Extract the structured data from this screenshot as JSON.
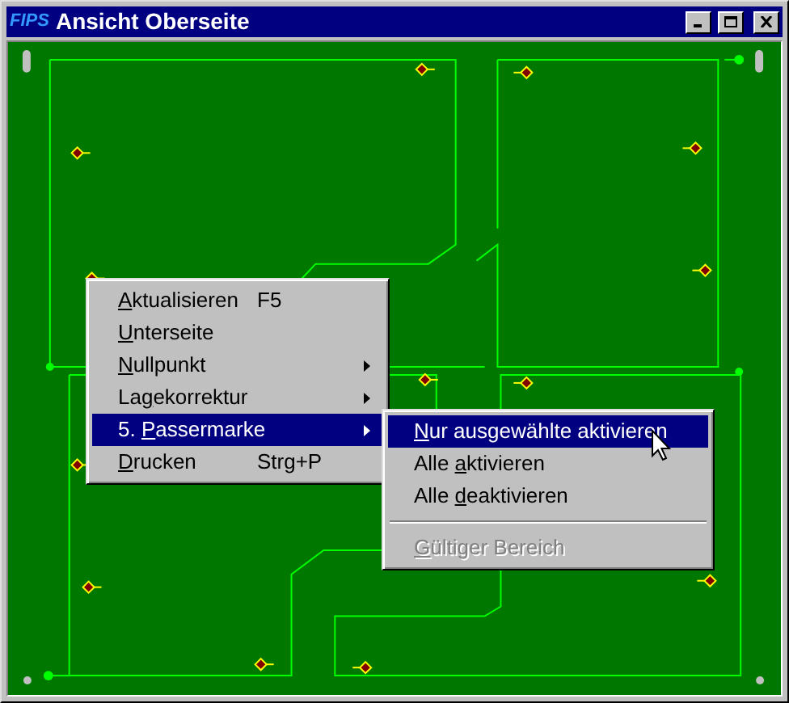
{
  "window": {
    "title": "Ansicht Oberseite",
    "logo": "FIPS"
  },
  "context_menu": [
    {
      "key": "A",
      "after": "ktualisieren",
      "shortcut": "F5",
      "submenu": false,
      "selected": false
    },
    {
      "key": "U",
      "after": "nterseite",
      "submenu": false,
      "selected": false
    },
    {
      "key": "N",
      "after": "ullpunkt",
      "submenu": true,
      "selected": false
    },
    {
      "before": "La",
      "key": "g",
      "after": "ekorrektur",
      "submenu": true,
      "selected": false
    },
    {
      "before": "5. ",
      "key": "P",
      "after": "assermarke",
      "submenu": true,
      "selected": true
    },
    {
      "key": "D",
      "after": "rucken",
      "shortcut": "Strg+P",
      "submenu": false,
      "selected": false
    }
  ],
  "submenu": [
    {
      "kind": "item",
      "key": "N",
      "after": "ur ausgewählte aktivieren",
      "selected": true,
      "disabled": false
    },
    {
      "kind": "item",
      "before": "Alle ",
      "key": "a",
      "after": "ktivieren",
      "selected": false,
      "disabled": false
    },
    {
      "kind": "item",
      "before": "Alle ",
      "key": "d",
      "after": "eaktivieren",
      "selected": false,
      "disabled": false
    },
    {
      "kind": "separator"
    },
    {
      "kind": "item",
      "key": "G",
      "after": "ültiger Bereich",
      "selected": false,
      "disabled": true
    }
  ]
}
